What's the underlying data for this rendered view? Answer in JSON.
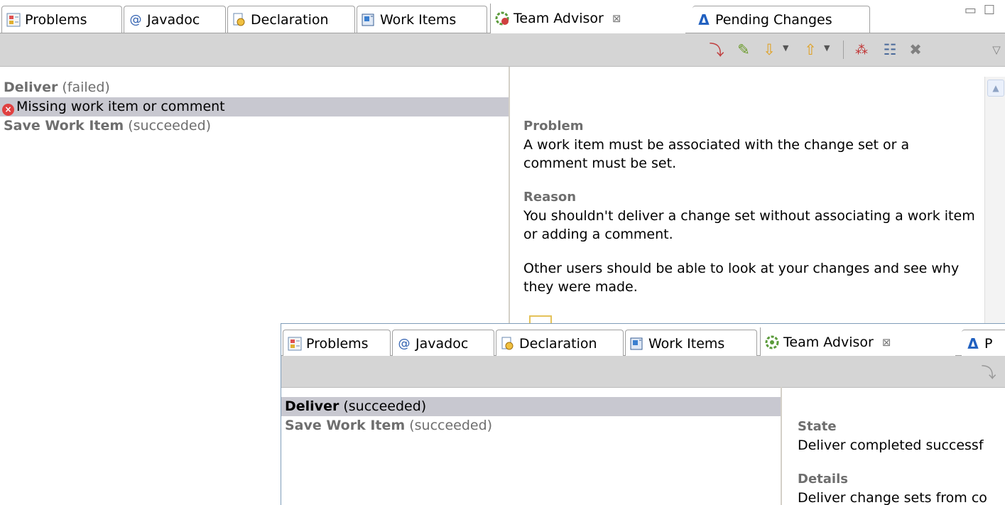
{
  "view1": {
    "tabs": [
      {
        "label": "Problems",
        "icon": "problems-icon"
      },
      {
        "label": "Javadoc",
        "icon": "javadoc-icon"
      },
      {
        "label": "Declaration",
        "icon": "declaration-icon"
      },
      {
        "label": "Work Items",
        "icon": "work-items-icon"
      },
      {
        "label": "Team Advisor",
        "icon": "team-advisor-icon",
        "active": true
      },
      {
        "label": "Pending Changes",
        "icon": "pending-changes-icon"
      }
    ],
    "tree": {
      "deliver_name": "Deliver",
      "deliver_status": "(failed)",
      "child_label": "Missing work item or comment",
      "save_name": "Save Work Item",
      "save_status": "(succeeded)"
    },
    "details": {
      "problem_heading": "Problem",
      "problem_text": "A work item must be associated with the change set or a comment must be set.",
      "reason_heading": "Reason",
      "reason_text": "You shouldn't deliver a change set without associating a work item or adding a comment.",
      "other_text": "Other users should be able to look at your changes and see why they were made."
    }
  },
  "view2": {
    "tabs": [
      {
        "label": "Problems",
        "icon": "problems-icon"
      },
      {
        "label": "Javadoc",
        "icon": "javadoc-icon"
      },
      {
        "label": "Declaration",
        "icon": "declaration-icon"
      },
      {
        "label": "Work Items",
        "icon": "work-items-icon"
      },
      {
        "label": "Team Advisor",
        "icon": "team-advisor-icon",
        "active": true
      },
      {
        "label": "P",
        "icon": "pending-changes-icon"
      }
    ],
    "tree": {
      "deliver_name": "Deliver",
      "deliver_status": "(succeeded)",
      "save_name": "Save Work Item",
      "save_status": "(succeeded)"
    },
    "details": {
      "state_heading": "State",
      "state_text": "Deliver completed successf",
      "details_heading": "Details",
      "details_text": "Deliver change sets from co"
    }
  },
  "colors": {
    "selection": "#c8c8d0",
    "toolbar": "#d5d5d5",
    "error": "#e04040"
  }
}
